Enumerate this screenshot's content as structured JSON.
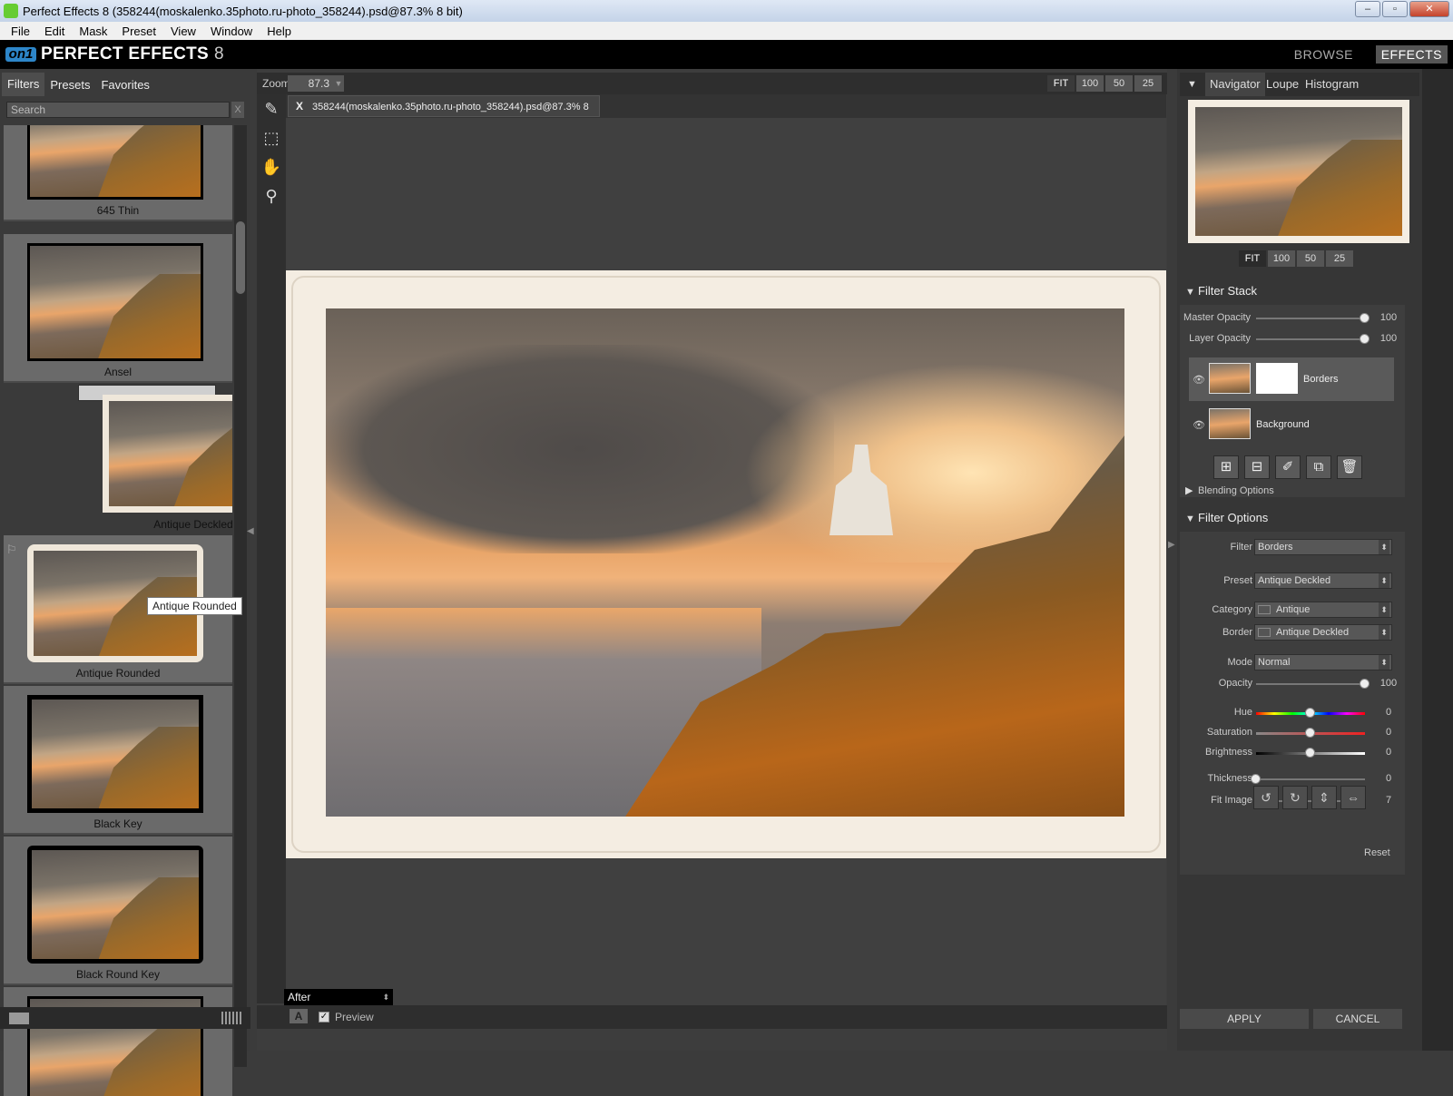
{
  "window": {
    "title": "Perfect Effects 8 (358244(moskalenko.35photo.ru-photo_358244).psd@87.3% 8 bit)",
    "minimize": "–",
    "restore": "▫",
    "close": "✕"
  },
  "menu": [
    "File",
    "Edit",
    "Mask",
    "Preset",
    "View",
    "Window",
    "Help"
  ],
  "brand": {
    "logo": "on1",
    "title": "PERFECT EFFECTS",
    "version": "8",
    "browse": "BROWSE",
    "effects": "EFFECTS"
  },
  "left": {
    "tabs": [
      "Filters",
      "Presets",
      "Favorites"
    ],
    "search_placeholder": "Search",
    "search_clear": "X",
    "presets": [
      "645 Thin",
      "Ansel",
      "Antique Deckled",
      "Antique Rounded",
      "Black Key",
      "Black Round Key"
    ],
    "selected": "Antique Deckled",
    "tooltip": "Antique Rounded"
  },
  "center": {
    "zoom_label": "Zoom",
    "zoom_value": "87.3",
    "zoom_buttons": [
      "FIT",
      "100",
      "50",
      "25"
    ],
    "doc_close": "X",
    "doc_tab": "358244(moskalenko.35photo.ru-photo_358244).psd@87.3% 8 bit",
    "view_mode": "After",
    "preview_label": "Preview",
    "preview_checked": true,
    "a_label": "A"
  },
  "right": {
    "nav_tabs": [
      "Navigator",
      "Loupe",
      "Histogram"
    ],
    "nav_buttons": [
      "FIT",
      "100",
      "50",
      "25"
    ],
    "filter_stack": {
      "title": "Filter Stack",
      "master_opacity": {
        "label": "Master Opacity",
        "value": "100",
        "level": 1.0
      },
      "layer_opacity": {
        "label": "Layer Opacity",
        "value": "100",
        "level": 1.0
      },
      "layers": [
        "Borders",
        "Background"
      ],
      "blending": "Blending Options"
    },
    "filter_options": {
      "title": "Filter Options",
      "filter": {
        "label": "Filter",
        "value": "Borders"
      },
      "preset": {
        "label": "Preset",
        "value": "Antique Deckled"
      },
      "category": {
        "label": "Category",
        "value": "Antique"
      },
      "border": {
        "label": "Border",
        "value": "Antique Deckled"
      },
      "mode": {
        "label": "Mode",
        "value": "Normal"
      },
      "opacity": {
        "label": "Opacity",
        "value": "100",
        "level": 1.0
      },
      "hue": {
        "label": "Hue",
        "value": "0",
        "level": 0.5
      },
      "saturation": {
        "label": "Saturation",
        "value": "0",
        "level": 0.5
      },
      "brightness": {
        "label": "Brightness",
        "value": "0",
        "level": 0.5
      },
      "thickness": {
        "label": "Thickness",
        "value": "0",
        "level": 0.0
      },
      "fit_image": {
        "label": "Fit Image",
        "value": "7",
        "level": 0.35
      },
      "reset": "Reset"
    },
    "apply": "APPLY",
    "cancel": "CANCEL"
  },
  "colors": {
    "accent": "#2d86c9",
    "panel": "#3a3a3a",
    "selected_thumb": "#cfcfcf"
  }
}
